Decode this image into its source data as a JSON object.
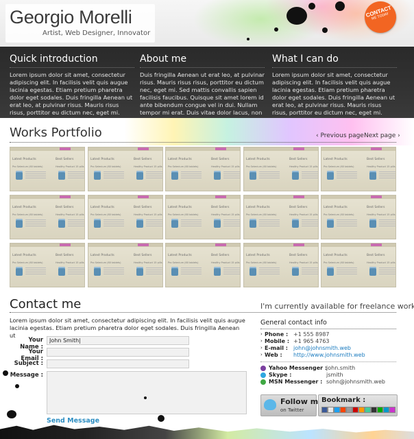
{
  "header": {
    "name": "Georgio Morelli",
    "tagline": "Artist, Web Designer, Innovator",
    "contact_badge": "CONTACT",
    "contact_badge_sub": "ME TODAY"
  },
  "intro": [
    {
      "title": "Quick introduction",
      "text": "Lorem ipsum dolor sit amet, consectetur adipiscing elit. In facilisis velit quis augue lacinia egestas. Etiam pretium pharetra dolor eget sodales. Duis fringilla Aenean ut erat leo, at pulvinar risus. Mauris risus risus, porttitor eu dictum nec, eget mi."
    },
    {
      "title": "About me",
      "text": "Duis fringilla Aenean ut erat leo, at pulvinar risus. Mauris risus risus, porttitor eu dictum nec, eget mi. Sed mattis convallis sapien facilisis faucibus. Quisque sit amet lorem id ante bibendum congue vel in dui. Nullam tempor mi erat. Duis vitae dolor lacus, non"
    },
    {
      "title": "What I can do",
      "text": "Lorem ipsum dolor sit amet, consectetur adipiscing elit. In facilisis velit quis augue lacinia egestas. Etiam pretium pharetra dolor eget sodales. Duis fringilla Aenean ut erat leo, at pulvinar risus. Mauris risus risus, porttitor eu dictum nec, eget mi."
    }
  ],
  "portfolio": {
    "title": "Works Portfolio",
    "prev": "Previous page",
    "next": "Next page",
    "thumb": {
      "heading_left": "Latest Products",
      "heading_right": "Best Sellers",
      "text_left": "Pro Selenium (60 tablets)",
      "text_right": "Healthy Product 15 pills"
    }
  },
  "contact": {
    "title": "Contact me",
    "freelance": "I'm currently available for freelance work !",
    "intro": "Lorem ipsum dolor sit amet, consectetur adipiscing elit. In facilisis velit quis augue lacinia egestas. Etiam pretium pharetra dolor eget sodales. Duis fringilla Aenean ut",
    "form": {
      "name_label": "Your Name :",
      "name_value": "John Smith|",
      "email_label": "Your Email :",
      "email_value": "",
      "subject_label": "Subject :",
      "subject_value": "",
      "message_label": "Message :",
      "message_value": "",
      "send": "Send Message"
    }
  },
  "general": {
    "title": "General contact info",
    "rows": [
      {
        "label": "Phone :",
        "value": "+1 555 8987"
      },
      {
        "label": "Mobile :",
        "value": "+1 965 4763"
      },
      {
        "label": "E-mail :",
        "value": "john@johnsmith.web"
      },
      {
        "label": "Web :",
        "value": "http://www.johnsmith.web"
      }
    ],
    "messengers": [
      {
        "label": "Yahoo Messenger :",
        "value": "john.smith",
        "color": "#7b3fa0"
      },
      {
        "label": "Skype :",
        "value": "jsmith",
        "color": "#2fa7e0"
      },
      {
        "label": "MSN Messenger :",
        "value": "sohn@johnsmith.web",
        "color": "#3fa843"
      }
    ],
    "follow_main": "Follow me",
    "follow_sub": "on Twitter",
    "bookmark": "Bookmark :"
  },
  "colors": {
    "accent": "#f26522",
    "link": "#1a7bbf",
    "send": "#2f8fc3",
    "dark_band": "#333333"
  }
}
